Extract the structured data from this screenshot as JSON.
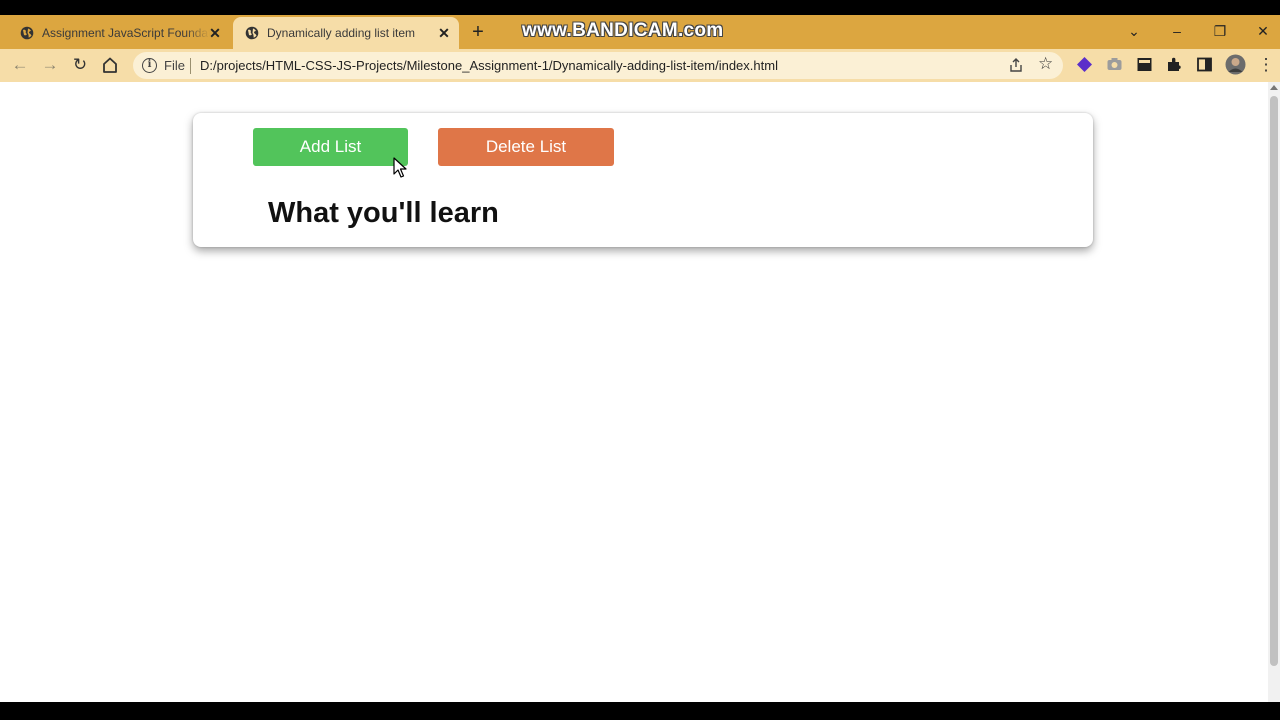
{
  "browser": {
    "tabs": [
      {
        "title": "Assignment JavaScript Foundation",
        "active": false,
        "icon": "globe-icon"
      },
      {
        "title": "Dynamically adding list item",
        "active": true,
        "icon": "globe-icon"
      }
    ],
    "new_tab_label": "+",
    "watermark": "www.BANDICAM.com",
    "url_scheme": "File",
    "url": "D:/projects/HTML-CSS-JS-Projects/Milestone_Assignment-1/Dynamically-adding-list-item/index.html",
    "colors": {
      "tabstrip": "#dca640",
      "toolbar": "#f6dda8"
    }
  },
  "page": {
    "add_button": "Add List",
    "delete_button": "Delete List",
    "heading": "What you'll learn",
    "colors": {
      "add": "#52c45b",
      "delete": "#df7648"
    }
  }
}
